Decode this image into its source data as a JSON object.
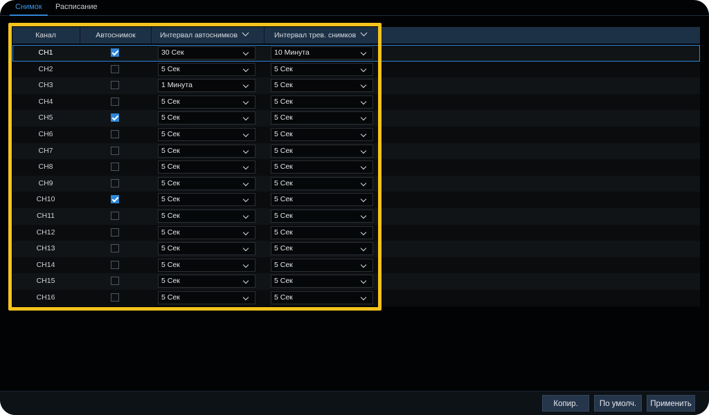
{
  "tabs": [
    {
      "label": "Снимок",
      "active": true
    },
    {
      "label": "Расписание",
      "active": false
    }
  ],
  "table": {
    "headers": {
      "channel": "Канал",
      "auto": "Автоснимок",
      "auto_interval": "Интервал автоснимков",
      "alarm_interval": "Интервал трев. снимков"
    },
    "rows": [
      {
        "channel": "CH1",
        "auto": true,
        "auto_interval": "30 Сек",
        "alarm_interval": "10 Минута",
        "selected": true
      },
      {
        "channel": "CH2",
        "auto": false,
        "auto_interval": "5 Сек",
        "alarm_interval": "5 Сек"
      },
      {
        "channel": "CH3",
        "auto": false,
        "auto_interval": "1 Минута",
        "alarm_interval": "5 Сек"
      },
      {
        "channel": "CH4",
        "auto": false,
        "auto_interval": "5 Сек",
        "alarm_interval": "5 Сек"
      },
      {
        "channel": "CH5",
        "auto": true,
        "auto_interval": "5 Сек",
        "alarm_interval": "5 Сек"
      },
      {
        "channel": "CH6",
        "auto": false,
        "auto_interval": "5 Сек",
        "alarm_interval": "5 Сек"
      },
      {
        "channel": "CH7",
        "auto": false,
        "auto_interval": "5 Сек",
        "alarm_interval": "5 Сек"
      },
      {
        "channel": "CH8",
        "auto": false,
        "auto_interval": "5 Сек",
        "alarm_interval": "5 Сек"
      },
      {
        "channel": "CH9",
        "auto": false,
        "auto_interval": "5 Сек",
        "alarm_interval": "5 Сек"
      },
      {
        "channel": "CH10",
        "auto": true,
        "auto_interval": "5 Сек",
        "alarm_interval": "5 Сек"
      },
      {
        "channel": "CH11",
        "auto": false,
        "auto_interval": "5 Сек",
        "alarm_interval": "5 Сек"
      },
      {
        "channel": "CH12",
        "auto": false,
        "auto_interval": "5 Сек",
        "alarm_interval": "5 Сек"
      },
      {
        "channel": "CH13",
        "auto": false,
        "auto_interval": "5 Сек",
        "alarm_interval": "5 Сек"
      },
      {
        "channel": "CH14",
        "auto": false,
        "auto_interval": "5 Сек",
        "alarm_interval": "5 Сек"
      },
      {
        "channel": "CH15",
        "auto": false,
        "auto_interval": "5 Сек",
        "alarm_interval": "5 Сек"
      },
      {
        "channel": "CH16",
        "auto": false,
        "auto_interval": "5 Сек",
        "alarm_interval": "5 Сек"
      }
    ]
  },
  "footer": {
    "copy_label": "Копир.",
    "default_label": "По умолч.",
    "apply_label": "Применить"
  },
  "colors": {
    "accent": "#2f86d8",
    "highlight_frame": "#f5c31c",
    "background": "#020304"
  }
}
